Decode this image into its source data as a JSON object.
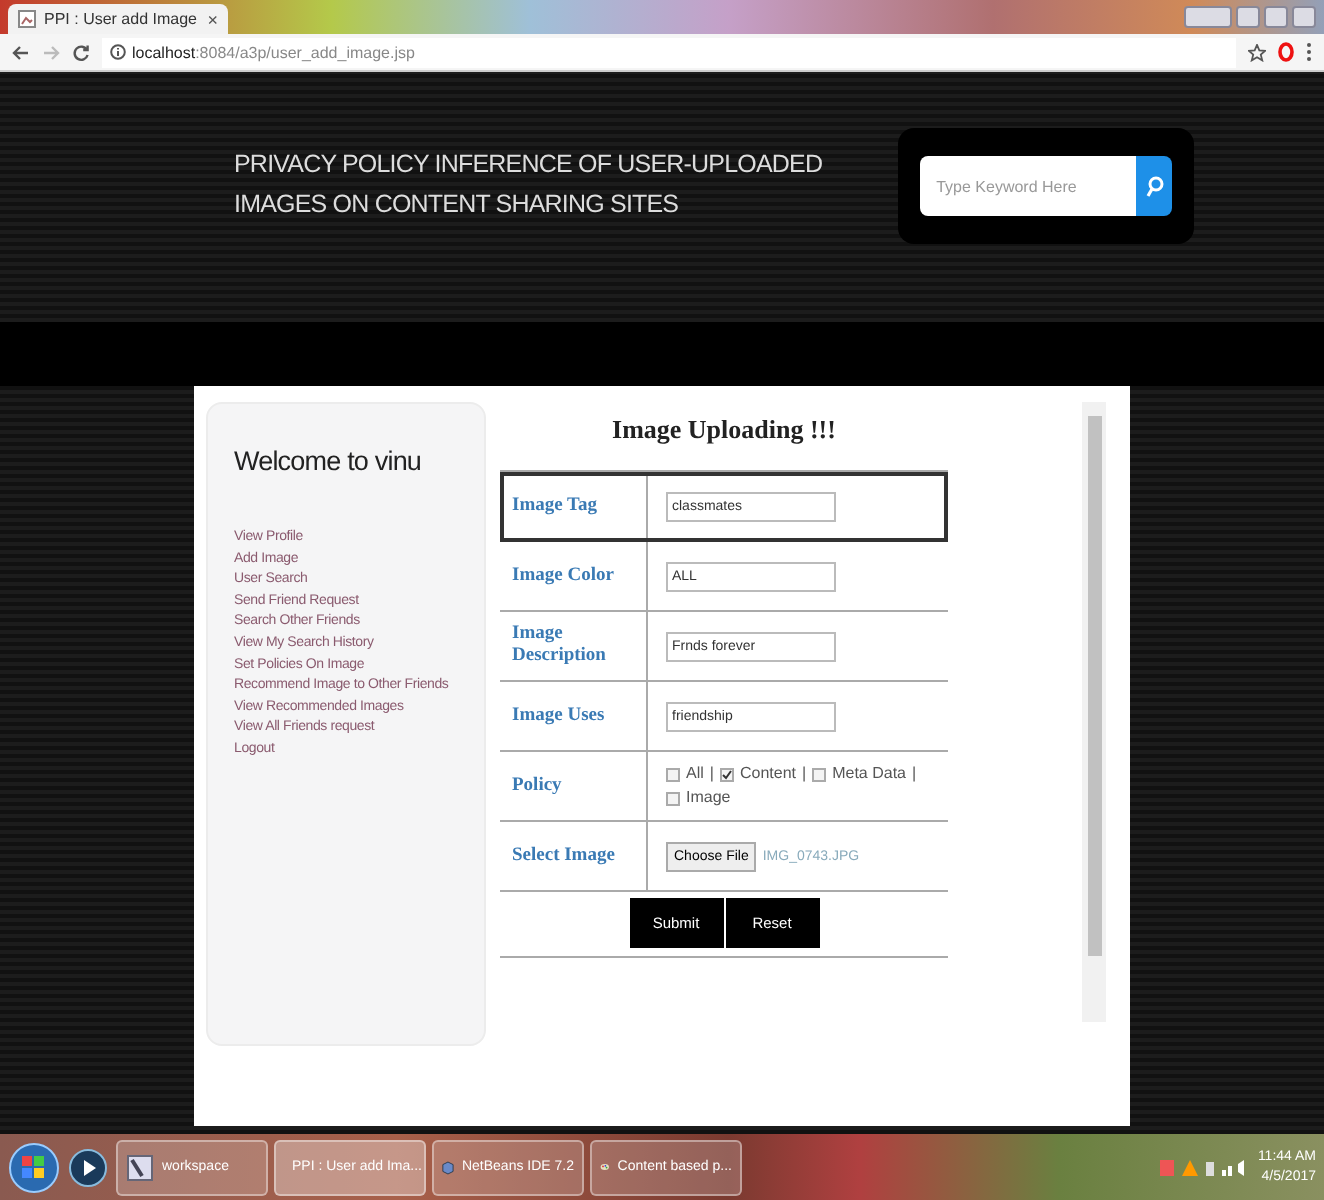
{
  "browser": {
    "tab_title": "PPI : User add Image",
    "tab_close": "×",
    "url_host": "localhost",
    "url_path": ":8084/a3p/user_add_image.jsp"
  },
  "header": {
    "title_lines": [
      "PRIVACY POLICY INFERENCE OF USER-UPLOADED",
      "IMAGES ON CONTENT SHARING SITES"
    ],
    "search": {
      "placeholder": "Type Keyword Here"
    }
  },
  "sidebar": {
    "welcome": "Welcome to vinu",
    "links": [
      "View Profile",
      "Add Image",
      "User Search",
      "Send Friend Request",
      "Search Other Friends",
      "View My Search History",
      "Set Policies On Image",
      "Recommend Image to Other Friends",
      "View Recommended Images",
      "View All Friends request",
      "Logout"
    ]
  },
  "form": {
    "title": "Image Uploading !!!",
    "separator": "|",
    "rows": [
      {
        "kind": "text",
        "label": "Image Tag",
        "value": "classmates",
        "focused": true
      },
      {
        "kind": "text",
        "label": "Image Color",
        "value": "ALL",
        "focused": false
      },
      {
        "kind": "text",
        "label": "Image Description",
        "value": "Frnds forever",
        "focused": false
      },
      {
        "kind": "text",
        "label": "Image Uses",
        "value": "friendship",
        "focused": false
      },
      {
        "kind": "checks",
        "label": "Policy",
        "focused": false,
        "options": [
          {
            "label": "All",
            "checked": false
          },
          {
            "label": "Content",
            "checked": true
          },
          {
            "label": "Meta Data",
            "checked": false
          },
          {
            "label": "Image",
            "checked": false
          }
        ]
      },
      {
        "kind": "file",
        "label": "Select Image",
        "button": "Choose File",
        "value": "IMG_0743.JPG",
        "focused": false
      }
    ],
    "buttons": [
      "Submit",
      "Reset"
    ]
  },
  "taskbar": {
    "items": [
      {
        "label": "workspace",
        "kind": "folder"
      },
      {
        "label": "PPI : User add Ima...",
        "kind": "browser"
      },
      {
        "label": "NetBeans IDE 7.2",
        "kind": "cube"
      },
      {
        "label": "Content based p...",
        "kind": "paint"
      }
    ],
    "time": "11:44 AM",
    "date": "4/5/2017"
  }
}
